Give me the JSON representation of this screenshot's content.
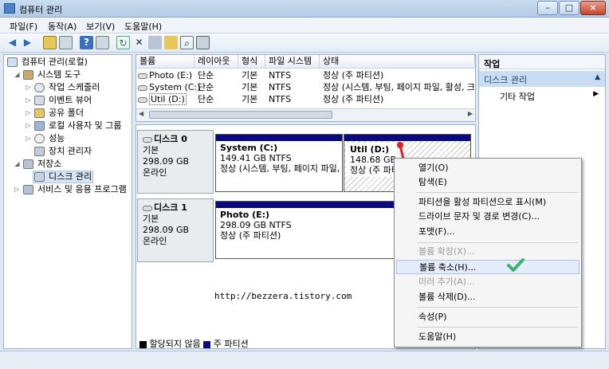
{
  "window": {
    "title": "컴퓨터 관리"
  },
  "menu": [
    "파일(F)",
    "동작(A)",
    "보기(V)",
    "도움말(H)"
  ],
  "tree": {
    "root": "컴퓨터 관리(로컬)",
    "system_tools": "시스템 도구",
    "task_scheduler": "작업 스케줄러",
    "event_viewer": "이벤트 뷰어",
    "shared_folders": "공유 폴더",
    "local_users": "로컬 사용자 및 그룹",
    "performance": "성능",
    "device_manager": "장치 관리자",
    "storage": "저장소",
    "disk_management": "디스크 관리",
    "services": "서비스 및 응용 프로그램"
  },
  "volume_table": {
    "headers": [
      "볼륨",
      "레이아웃",
      "형식",
      "파일 시스템",
      "상태"
    ],
    "rows": [
      [
        "Photo (E:)",
        "단순",
        "기본",
        "NTFS",
        "정상 (주 파티션)"
      ],
      [
        "System (C:)",
        "단순",
        "기본",
        "NTFS",
        "정상 (시스템, 부팅, 페이지 파일, 활성, 크"
      ],
      [
        "Util (D:)",
        "단순",
        "기본",
        "NTFS",
        "정상 (주 파티션)"
      ]
    ]
  },
  "disks": [
    {
      "name": "디스크 0",
      "type": "기본",
      "size": "298.09 GB",
      "state": "온라인"
    },
    {
      "name": "디스크 1",
      "type": "기본",
      "size": "298.09 GB",
      "state": "온라인"
    }
  ],
  "partitions": {
    "system": {
      "name": "System  (C:)",
      "size": "149.41 GB NTFS",
      "status": "정상 (시스템, 부팅, 페이지 파일,"
    },
    "util": {
      "name": "Util  (D:)",
      "size": "148.68 GB N",
      "status": "정상 (주 파티"
    },
    "photo": {
      "name": "Photo  (E:)",
      "size": "298.09 GB NTFS",
      "status": "정상 (주 파티션)"
    }
  },
  "watermark": "http://bezzera.tistory.com",
  "legend": {
    "unallocated": "할당되지 않음",
    "primary": "주 파티션"
  },
  "actions": {
    "header": "작업",
    "section": "디스크 관리",
    "more": "기타 작업"
  },
  "context_menu": {
    "open": "열기(O)",
    "explore": "탐색(E)",
    "mark_active": "파티션을 활성 파티션으로 표시(M)",
    "change_letter": "드라이브 문자 및 경로 변경(C)...",
    "format": "포맷(F)...",
    "extend": "볼륨 확장(X)...",
    "shrink": "볼륨 축소(H)...",
    "mirror": "미러 추가(A)...",
    "delete": "볼륨 삭제(D)...",
    "properties": "속성(P)",
    "help": "도움말(H)"
  },
  "colors": {
    "primary_partition": "#0a0a80",
    "highlight": "#d5e4f7",
    "checkmark": "#3cb371",
    "arrow": "#e02020"
  }
}
